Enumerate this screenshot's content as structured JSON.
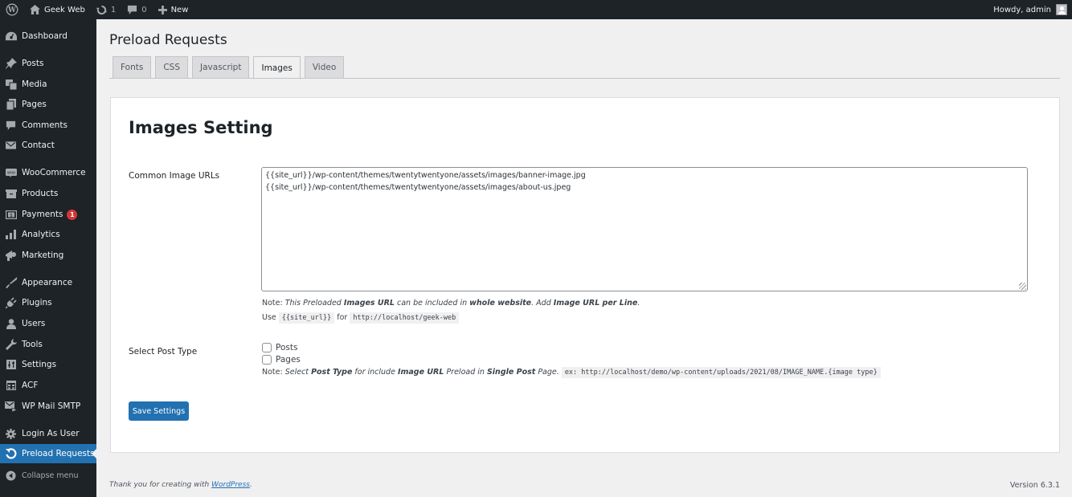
{
  "adminbar": {
    "wp_logo": "wordpress-logo-icon",
    "site_name": "Geek Web",
    "updates_count": "1",
    "comments_count": "0",
    "new_label": "New",
    "greeting": "Howdy, admin"
  },
  "sidebar": {
    "items": [
      {
        "label": "Dashboard",
        "icon": "dashboard-icon"
      },
      {
        "label": "Posts",
        "icon": "pin-icon"
      },
      {
        "label": "Media",
        "icon": "media-icon"
      },
      {
        "label": "Pages",
        "icon": "pages-icon"
      },
      {
        "label": "Comments",
        "icon": "comment-icon"
      },
      {
        "label": "Contact",
        "icon": "mail-icon"
      },
      {
        "label": "WooCommerce",
        "icon": "woocommerce-icon"
      },
      {
        "label": "Products",
        "icon": "archive-icon"
      },
      {
        "label": "Payments",
        "icon": "payment-icon",
        "badge": "1"
      },
      {
        "label": "Analytics",
        "icon": "bar-chart-icon"
      },
      {
        "label": "Marketing",
        "icon": "megaphone-icon"
      },
      {
        "label": "Appearance",
        "icon": "brush-icon"
      },
      {
        "label": "Plugins",
        "icon": "plug-icon"
      },
      {
        "label": "Users",
        "icon": "user-icon"
      },
      {
        "label": "Tools",
        "icon": "wrench-icon"
      },
      {
        "label": "Settings",
        "icon": "sliders-icon"
      },
      {
        "label": "ACF",
        "icon": "table-icon"
      },
      {
        "label": "WP Mail SMTP",
        "icon": "mail-send-icon"
      },
      {
        "label": "Login As User",
        "icon": "gear-icon"
      },
      {
        "label": "Preload Requests",
        "icon": "refresh-icon",
        "current": true
      }
    ],
    "collapse_label": "Collapse menu"
  },
  "page": {
    "title": "Preload Requests",
    "tabs": [
      {
        "label": "Fonts"
      },
      {
        "label": "CSS"
      },
      {
        "label": "Javascript"
      },
      {
        "label": "Images",
        "active": true
      },
      {
        "label": "Video"
      }
    ]
  },
  "settings": {
    "heading": "Images Setting",
    "image_urls_label": "Common Image URLs",
    "image_urls_value": "{{site_url}}/wp-content/themes/twentytwentyone/assets/images/banner-image.jpg\n{{site_url}}/wp-content/themes/twentytwentyone/assets/images/about-us.jpeg",
    "note1": {
      "prefix": "Note:",
      "t1": " This Preloaded ",
      "b1": "Images URL",
      "t2": " can be included in ",
      "b2": "whole website",
      "t3": ". Add ",
      "b3": "Image URL per Line",
      "t4": "."
    },
    "use_line": {
      "use": "Use",
      "placeholder_code": "{{site_url}}",
      "for": "for",
      "url_code": "http://localhost/geek-web"
    },
    "post_type_label": "Select Post Type",
    "post_types": [
      {
        "label": "Posts",
        "checked": false
      },
      {
        "label": "Pages",
        "checked": false
      }
    ],
    "note2": {
      "prefix": "Note:",
      "t1": " Select ",
      "b1": "Post Type",
      "t2": " for include ",
      "b2": "Image URL",
      "t3": " Preload in ",
      "b3": "Single Post",
      "t4": " Page.",
      "example_code": "ex: http://localhost/demo/wp-content/uploads/2021/08/IMAGE_NAME.{image type}"
    },
    "save_label": "Save Settings"
  },
  "footer": {
    "thanks_prefix": "Thank you for creating with ",
    "thanks_link": "WordPress",
    "thanks_suffix": ".",
    "version": "Version 6.3.1"
  }
}
